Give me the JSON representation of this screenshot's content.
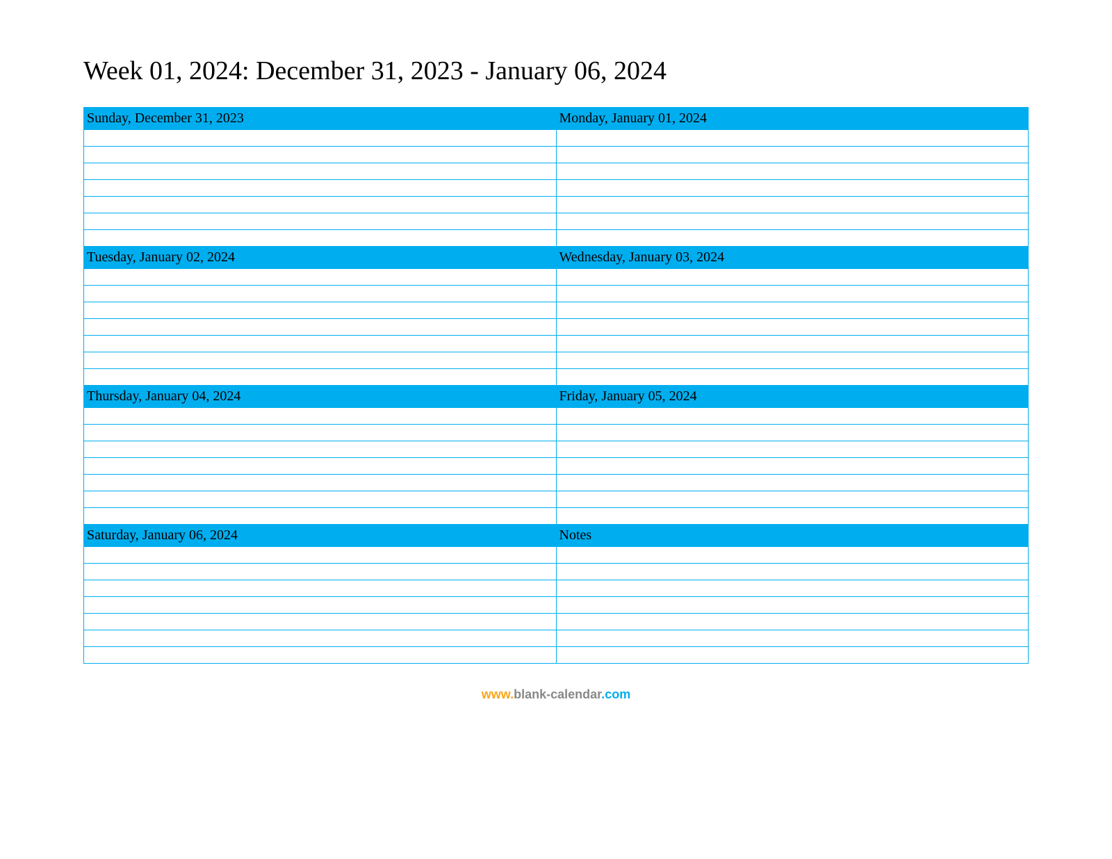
{
  "title": "Week 01, 2024: December 31, 2023 - January 06, 2024",
  "days": {
    "sunday": "Sunday, December 31, 2023",
    "monday": "Monday, January 01, 2024",
    "tuesday": "Tuesday, January 02, 2024",
    "wednesday": "Wednesday, January 03, 2024",
    "thursday": "Thursday, January 04, 2024",
    "friday": "Friday, January 05, 2024",
    "saturday": "Saturday, January 06, 2024",
    "notes": "Notes"
  },
  "footer": {
    "www": "www.",
    "domain": "blank-calendar",
    "tld": ".com"
  },
  "colors": {
    "accent": "#00aeef",
    "orange": "#f9a61a",
    "gray": "#888"
  },
  "rows_per_block": 7
}
